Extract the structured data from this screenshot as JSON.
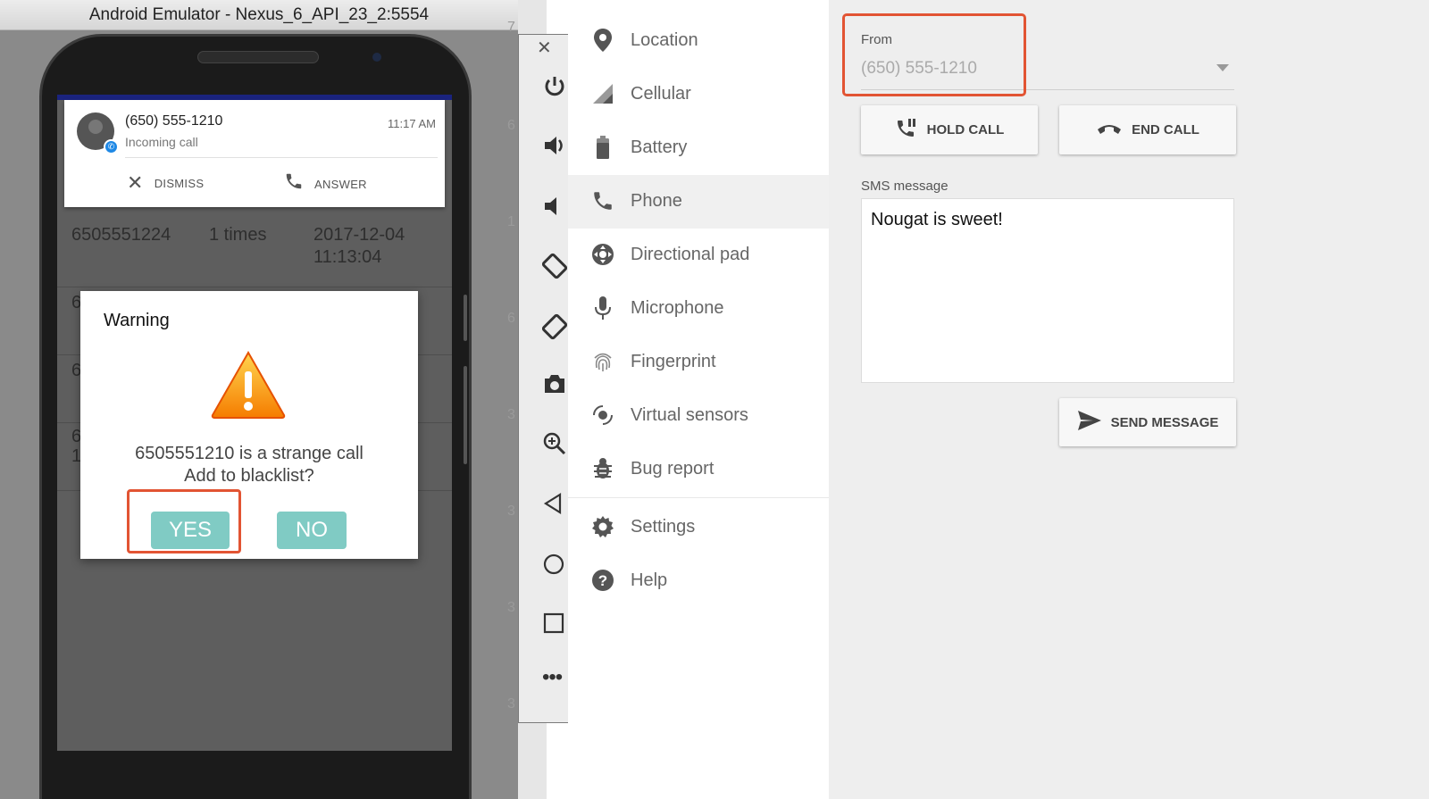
{
  "emulator": {
    "title": "Android Emulator - Nexus_6_API_23_2:5554",
    "background_digits": [
      "7",
      "6",
      "1",
      "6",
      "3",
      "3",
      "3",
      "3"
    ]
  },
  "notification": {
    "caller": "(650) 555-1210",
    "subtitle": "Incoming call",
    "time": "11:17 AM",
    "dismiss_label": "DISMISS",
    "answer_label": "ANSWER"
  },
  "call_log": {
    "rows": [
      {
        "number": "6505551224",
        "count": "1 times",
        "date": "2017-12-04",
        "time": "11:13:04"
      },
      {
        "number": "6",
        "count": "",
        "date": "",
        "time": ""
      },
      {
        "number": "6",
        "count": "",
        "date": "",
        "time": ""
      },
      {
        "number": "6",
        "count": "",
        "date": "",
        "time": "1"
      }
    ]
  },
  "dialog": {
    "title": "Warning",
    "message_line1": "6505551210 is a strange call",
    "message_line2": "Add to blacklist?",
    "yes_label": "YES",
    "no_label": "NO"
  },
  "menu": {
    "items": [
      {
        "label": "Location",
        "icon": "location-pin-icon"
      },
      {
        "label": "Cellular",
        "icon": "cellular-signal-icon"
      },
      {
        "label": "Battery",
        "icon": "battery-icon"
      },
      {
        "label": "Phone",
        "icon": "phone-icon"
      },
      {
        "label": "Directional pad",
        "icon": "dpad-icon"
      },
      {
        "label": "Microphone",
        "icon": "microphone-icon"
      },
      {
        "label": "Fingerprint",
        "icon": "fingerprint-icon"
      },
      {
        "label": "Virtual sensors",
        "icon": "virtual-sensors-icon"
      },
      {
        "label": "Bug report",
        "icon": "bug-icon"
      },
      {
        "label": "Settings",
        "icon": "gear-icon"
      },
      {
        "label": "Help",
        "icon": "help-icon"
      }
    ],
    "active": "Phone"
  },
  "phone_panel": {
    "from_label": "From",
    "from_value": "(650) 555-1210",
    "hold_call_label": "HOLD CALL",
    "end_call_label": "END CALL",
    "sms_label": "SMS message",
    "sms_value": "Nougat is sweet!",
    "send_label": "SEND MESSAGE"
  },
  "colors": {
    "highlight": "#e25433",
    "dialog_button": "#80cbc4",
    "accent_blue": "#1e88e5"
  }
}
